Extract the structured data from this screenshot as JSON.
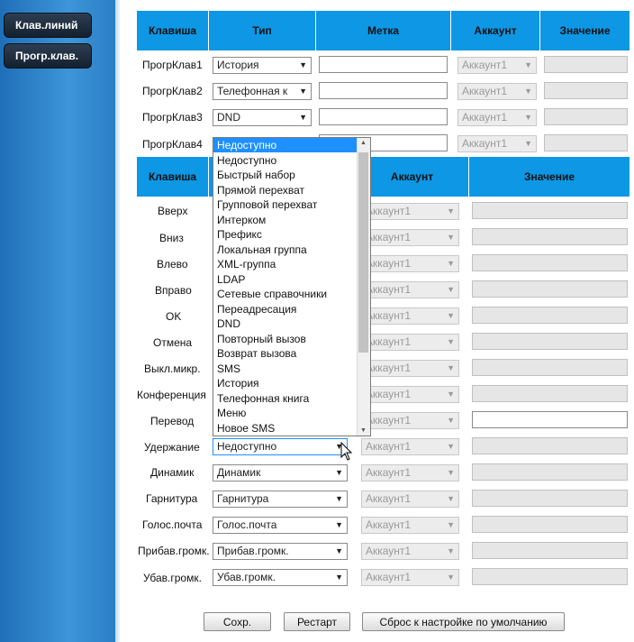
{
  "sidebar": {
    "items": [
      {
        "label": "Клав.линий"
      },
      {
        "label": "Прогр.клав."
      }
    ]
  },
  "table1": {
    "headers": [
      "Клавиша",
      "Тип",
      "Метка",
      "Аккаунт",
      "Значение"
    ],
    "rows": [
      {
        "key": "ПрогрКлав1",
        "type": "История",
        "account": "Аккаунт1"
      },
      {
        "key": "ПрогрКлав2",
        "type": "Телефонная к",
        "account": "Аккаунт1"
      },
      {
        "key": "ПрогрКлав3",
        "type": "DND",
        "account": "Аккаунт1"
      },
      {
        "key": "ПрогрКлав4",
        "type": "Недоступно",
        "account": "Аккаунт1"
      }
    ]
  },
  "table2": {
    "headers": [
      "Клавиша",
      "Аккаунт",
      "Значение"
    ],
    "rows": [
      {
        "key": "Вверх",
        "type": "",
        "account": "Аккаунт1"
      },
      {
        "key": "Вниз",
        "type": "",
        "account": "Аккаунт1"
      },
      {
        "key": "Влево",
        "type": "",
        "account": "Аккаунт1"
      },
      {
        "key": "Вправо",
        "type": "",
        "account": "Аккаунт1"
      },
      {
        "key": "OK",
        "type": "",
        "account": "Аккаунт1"
      },
      {
        "key": "Отмена",
        "type": "",
        "account": "Аккаунт1"
      },
      {
        "key": "Выкл.микр.",
        "type": "",
        "account": "Аккаунт1"
      },
      {
        "key": "Конференция",
        "type": "",
        "account": "Аккаунт1"
      },
      {
        "key": "Перевод",
        "type": "",
        "account": "Аккаунт1"
      },
      {
        "key": "Удержание",
        "type": "Недоступно",
        "account": "Аккаунт1"
      },
      {
        "key": "Динамик",
        "type": "Динамик",
        "account": "Аккаунт1"
      },
      {
        "key": "Гарнитура",
        "type": "Гарнитура",
        "account": "Аккаунт1"
      },
      {
        "key": "Голос.почта",
        "type": "Голос.почта",
        "account": "Аккаунт1"
      },
      {
        "key": "Прибав.громк.",
        "type": "Прибав.громк.",
        "account": "Аккаунт1"
      },
      {
        "key": "Убав.громк.",
        "type": "Убав.громк.",
        "account": "Аккаунт1"
      }
    ]
  },
  "dropdown": {
    "selected": "Недоступно",
    "options": [
      "Недоступно",
      "Быстрый набор",
      "Прямой перехват",
      "Групповой перехват",
      "Интерком",
      "Префикс",
      "Локальная группа",
      "XML-группа",
      "LDAP",
      "Сетевые справочники",
      "Переадресация",
      "DND",
      "Повторный вызов",
      "Возврат вызова",
      "SMS",
      "История",
      "Телефонная книга",
      "Меню",
      "Новое SMS"
    ]
  },
  "buttons": {
    "save": "Сохр.",
    "restart": "Рестарт",
    "reset": "Сброс к настройке по умолчанию"
  }
}
